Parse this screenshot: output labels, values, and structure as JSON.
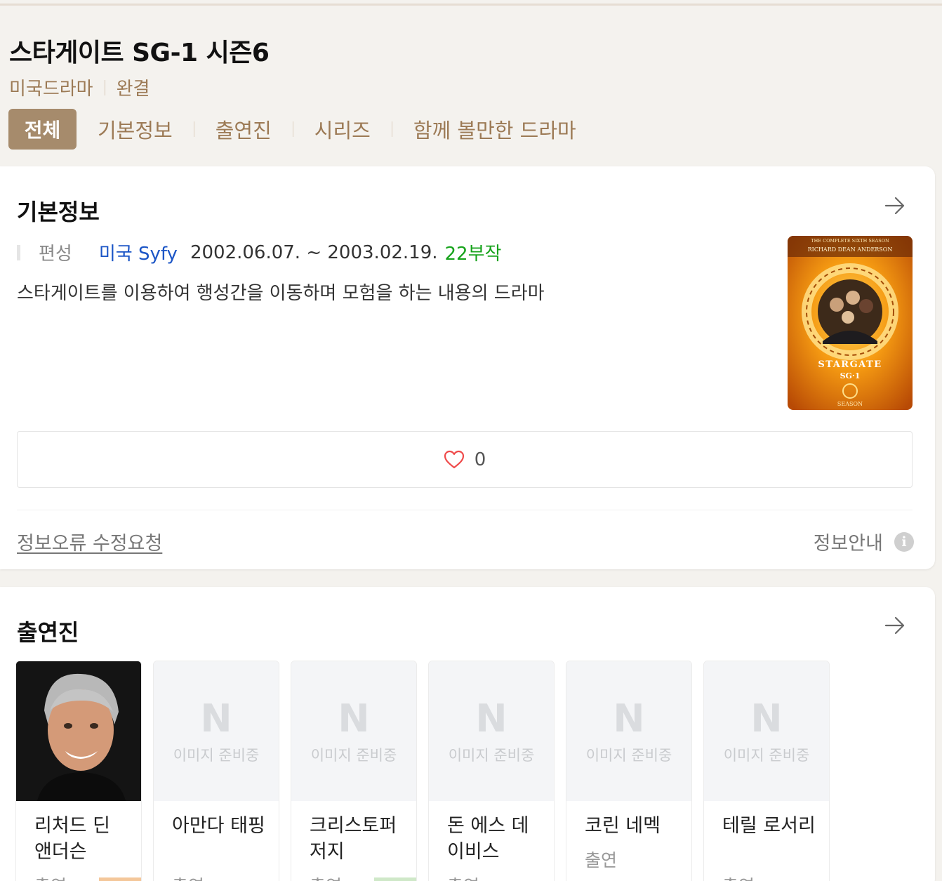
{
  "header": {
    "title": "스타게이트 SG-1 시즌6",
    "genre": "미국드라마",
    "status": "완결"
  },
  "tabs": [
    {
      "label": "전체",
      "active": true
    },
    {
      "label": "기본정보",
      "active": false
    },
    {
      "label": "출연진",
      "active": false
    },
    {
      "label": "시리즈",
      "active": false
    },
    {
      "label": "함께 볼만한 드라마",
      "active": false
    }
  ],
  "basic_info": {
    "section_title": "기본정보",
    "schedule_label": "편성",
    "channel": "미국 Syfy",
    "period": "2002.06.07. ~ 2003.02.19.",
    "episodes": "22부작",
    "description": "스타게이트를 이용하여 행성간을 이동하며 모험을 하는 내용의 드라마",
    "poster": {
      "top_text": "THE COMPLETE SIXTH SEASON",
      "actor_text": "RICHARD DEAN ANDERSON",
      "logo_text": "STARGATE",
      "logo_sub": "SG·1",
      "bottom_text": "SEASON"
    },
    "like_count": "0",
    "report_link": "정보오류 수정요청",
    "info_guide": "정보안내",
    "info_icon_glyph": "i"
  },
  "cast": {
    "section_title": "출연진",
    "placeholder_logo": "N",
    "placeholder_text": "이미지 준비중",
    "members": [
      {
        "name": "리처드 딘 앤더슨",
        "role": "출연",
        "has_photo": true
      },
      {
        "name": "아만다 태핑",
        "role": "출연",
        "has_photo": false
      },
      {
        "name": "크리스토퍼 저지",
        "role": "출연",
        "has_photo": false
      },
      {
        "name": "돈 에스 데이비스",
        "role": "출연",
        "has_photo": false
      },
      {
        "name": "코린 네멕",
        "role": "출연",
        "has_photo": false
      },
      {
        "name": "테릴 로서리",
        "role": "출연",
        "has_photo": false
      }
    ]
  },
  "colors": {
    "accent": "#a68b6c",
    "link_blue": "#1b55c6",
    "episodes_green": "#17a31c",
    "heart_red": "#ef4b4b"
  }
}
